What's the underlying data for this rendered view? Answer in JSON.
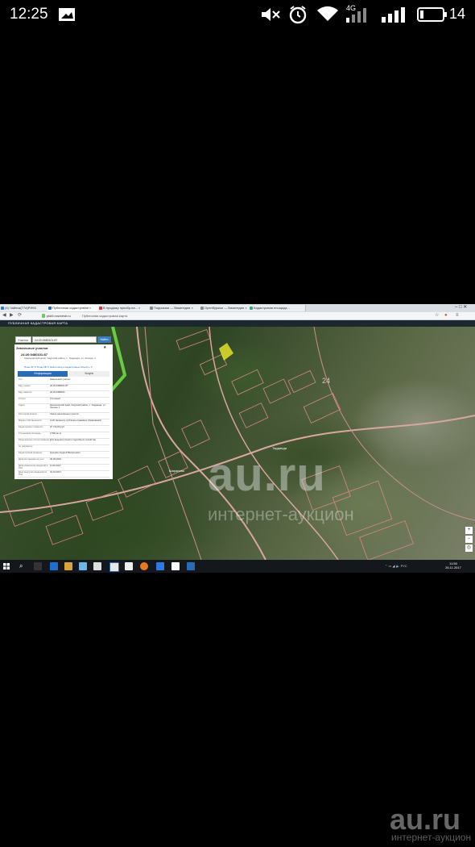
{
  "phone_status": {
    "time": "12:25",
    "network": "4G",
    "battery": "14"
  },
  "browser": {
    "tabs": [
      {
        "label": "(4) Чайник(77d)Р9Н6",
        "color": "#2d78d6"
      },
      {
        "label": "Публичная кадастровая ×",
        "color": "#2a6bb8"
      },
      {
        "label": "В продажу приобр.на... ×",
        "color": "#d33"
      },
      {
        "label": "Подсказки — Википедия ×",
        "color": "#888"
      },
      {
        "label": "Оренбуржья — Википедия ×",
        "color": "#888"
      },
      {
        "label": "Кадастровая площадь...",
        "color": "#3a7"
      }
    ],
    "url": "pkk5.rosreestr.ru",
    "page_title": "Публичная кадастровая карта",
    "map_header": "ПУБЛИЧНАЯ КАДАСТРОВАЯ КАРТА"
  },
  "search": {
    "type": "Участки",
    "query": "24:20:0480101:87",
    "button": "Найти"
  },
  "card": {
    "header": "Земельные участки",
    "number": "24:20:0480101:87",
    "address": "Красноярский край, Ужурский район, с. Тарданда, ул. Лесная, 1",
    "links": "План ЗУ ✕   План КВ ✕   Найти вход в кадастровые объекты ✕",
    "tab_info": "Информация",
    "tab_services": "Услуги",
    "rows": [
      {
        "k": "Тип",
        "v": "Земельный участок"
      },
      {
        "k": "Кад. номер",
        "v": "24:20:0480101:87"
      },
      {
        "k": "Кад. квартал",
        "v": "24:20:0480101"
      },
      {
        "k": "Статус",
        "v": "Учтенный"
      },
      {
        "k": "Адрес",
        "v": "Красноярский край, Ужурский район, с. Тарданда, ул. Лесная, 1"
      },
      {
        "k": "Категория земель",
        "v": "Земли населённых пунктов"
      },
      {
        "k": "Форма собственности",
        "v": "Собственность публично-правовых образований"
      },
      {
        "k": "Кадастровая стоимость",
        "v": "97 744,00 руб."
      },
      {
        "k": "Уточненная площадь",
        "v": "2 500 кв. м"
      },
      {
        "k": "Разрешенное использование",
        "v": "Для ведения личного подсобного хозяйства"
      },
      {
        "k": "по документу",
        "v": ""
      },
      {
        "k": "Кадастровый инженер",
        "v": "Кузьмин Андрей Валерьевич"
      },
      {
        "k": "Дата постановки на учет",
        "v": "26.09.2016"
      },
      {
        "k": "Дата изменения сведений в ГКН",
        "v": "11.09.2017"
      },
      {
        "k": "Дата выгрузки сведений из ГКН",
        "v": "31.01.2017"
      }
    ]
  },
  "map": {
    "labels": [
      "24",
      "Шарапово",
      "Тарданда"
    ],
    "watermark": "au.ru",
    "watermark_sub": "интернет-аукцион"
  },
  "taskbar": {
    "clock_time": "11:50",
    "clock_date": "26.11.2017",
    "tray": "РУС"
  },
  "bottom_watermark": {
    "brand": "au.ru",
    "sub": "интернет-аукцион"
  }
}
